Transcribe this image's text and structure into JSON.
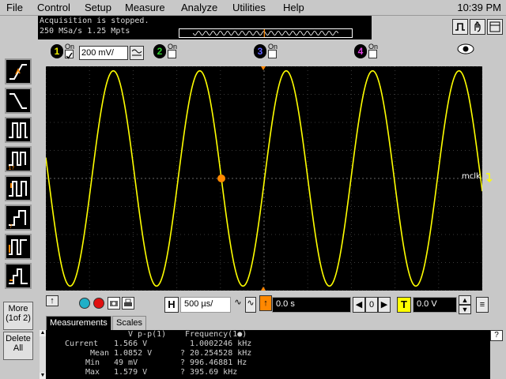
{
  "menu": {
    "items": [
      "File",
      "Control",
      "Setup",
      "Measure",
      "Analyze",
      "Utilities",
      "Help"
    ],
    "clock": "10:39 PM"
  },
  "status": {
    "line1": "Acquisition is stopped.",
    "line2": "250 MSa/s    1.25 Mpts"
  },
  "channels": [
    {
      "num": "1",
      "on_label": "On",
      "checked": true,
      "scale": "200 mV/",
      "color": "#f0f000"
    },
    {
      "num": "2",
      "on_label": "On",
      "checked": false,
      "color": "#30d030"
    },
    {
      "num": "3",
      "on_label": "On",
      "checked": false,
      "color": "#4040e0"
    },
    {
      "num": "4",
      "on_label": "On",
      "checked": false,
      "color": "#e040e0"
    }
  ],
  "left_panel": {
    "more": "More (1of 2)",
    "more_line1": "More",
    "more_line2": "(1of 2)",
    "delete_line1": "Delete",
    "delete_line2": "All"
  },
  "waveform": {
    "label": "mclk",
    "color": "#ffff00",
    "cycles": 5.05,
    "amplitude_fraction": 0.96,
    "phase_start": "falling-through-center"
  },
  "timebase": {
    "h_letter": "H",
    "scale": "500 µs/",
    "delay": "0.0 s"
  },
  "trigger": {
    "t_letter": "T",
    "level": "0.0 V"
  },
  "tabs": {
    "measurements": "Measurements",
    "scales": "Scales"
  },
  "measurements": {
    "col1_header": "V p-p(1)",
    "col2_header": "Frequency(1●)",
    "rows": [
      {
        "label": "Current",
        "v1": "1.566 V",
        "v2": "1.0002246 kHz"
      },
      {
        "label": "Mean",
        "v1": "1.0852 V",
        "v2": "? 20.254528 kHz"
      },
      {
        "label": "Min",
        "v1": "49 mV",
        "v2": "? 996.46881 Hz"
      },
      {
        "label": "Max",
        "v1": "1.579 V",
        "v2": "? 395.69 kHz"
      }
    ]
  },
  "colors": {
    "trace": "#ffff00",
    "marker": "#ff8800",
    "grid": "#3a3a3a"
  }
}
